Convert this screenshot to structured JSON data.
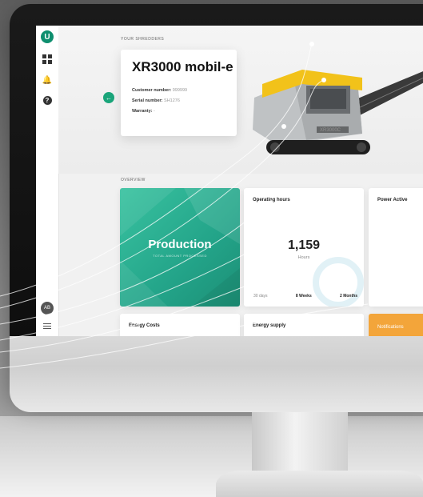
{
  "sidebar": {
    "logo": "U",
    "user_initials": "AB"
  },
  "hero": {
    "section_label": "YOUR SHREDDERS",
    "machine_model": "XR3000 mobil-e",
    "customer_number_label": "Customer number:",
    "customer_number": "999999",
    "serial_number_label": "Serial number:",
    "serial_number": "SH1276",
    "warranty_label": "Warranty:",
    "warranty": "-",
    "machine_badge": "XR3000C"
  },
  "overview": {
    "section_label": "OVERVIEW",
    "production_title": "Production",
    "production_sub": "TOTAL AMOUNT PROCESSED",
    "operating_hours_title": "Operating hours",
    "operating_hours_value": "1,159",
    "operating_hours_unit": "Hours",
    "ranges": [
      "30 days",
      "8 Weeks",
      "2 Months"
    ],
    "power_title": "Power Active",
    "energy_costs_title": "Energy Costs",
    "energy_supply_title": "Energy supply",
    "notifications_title": "Notifications"
  },
  "colors": {
    "accent_green": "#1aa57a",
    "production_teal": "#23a489",
    "notification_orange": "#f3a53a"
  }
}
